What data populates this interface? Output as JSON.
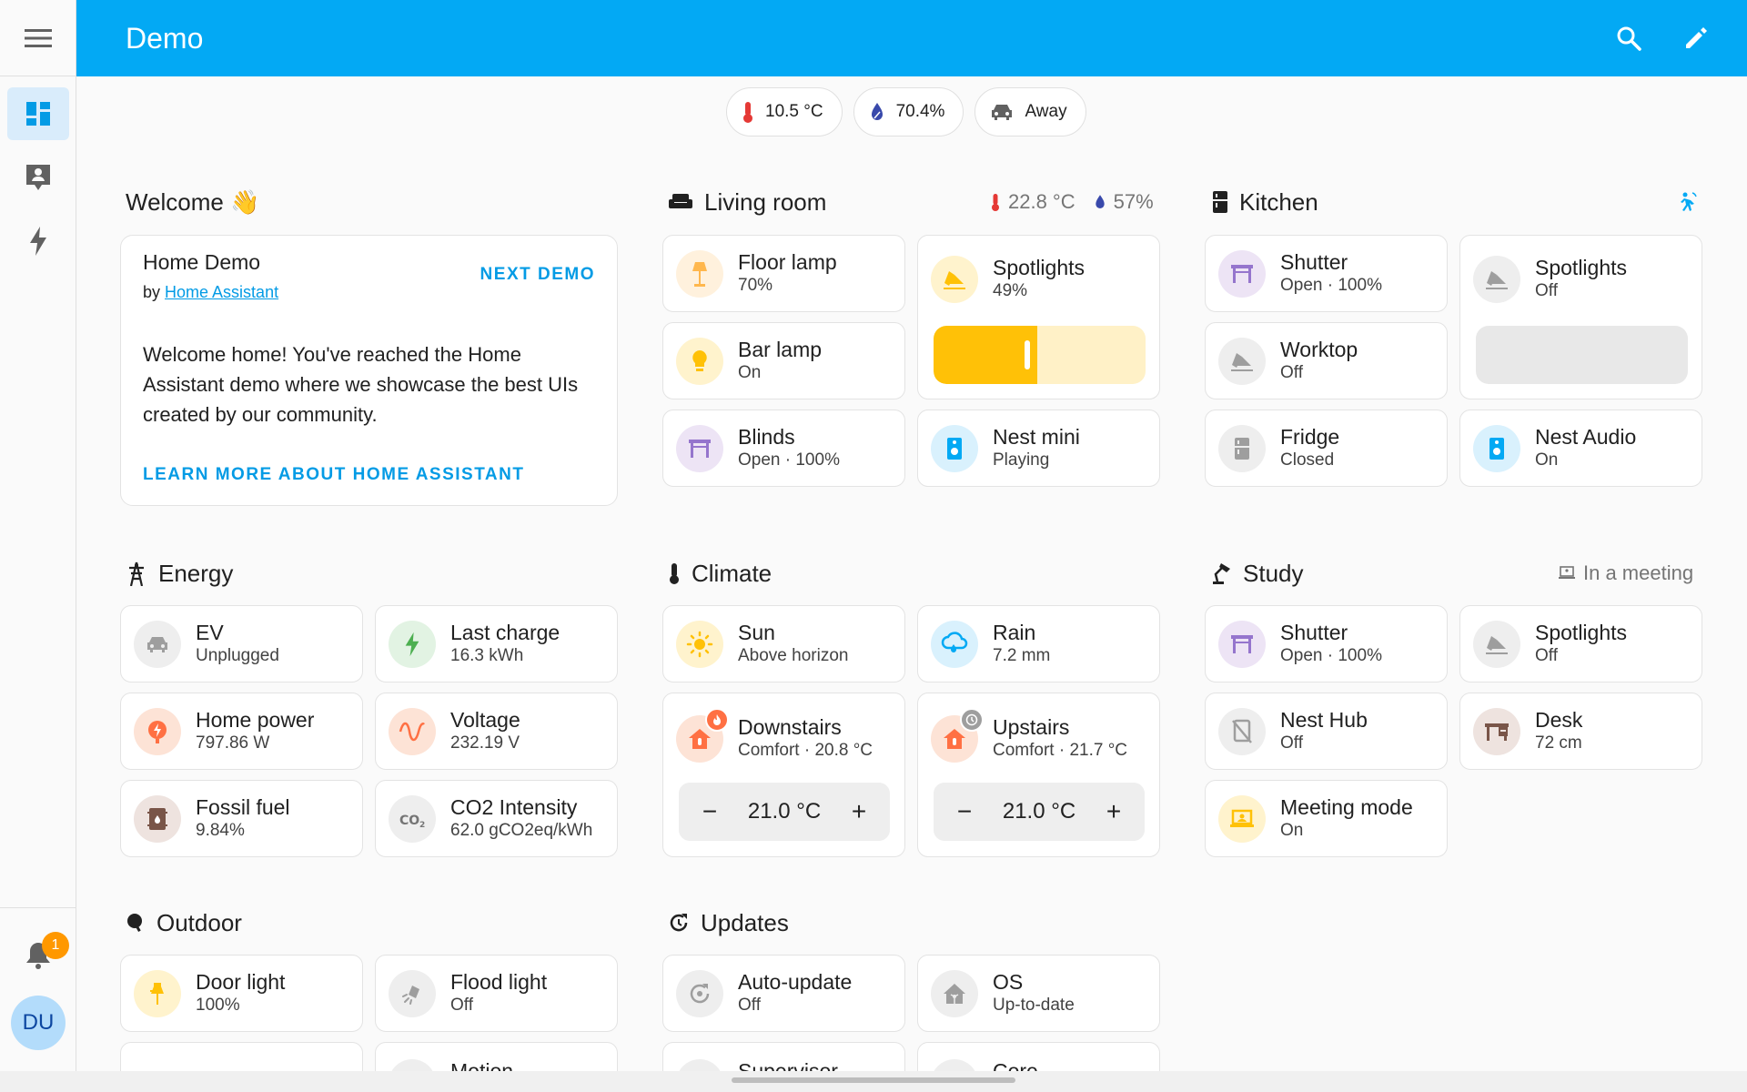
{
  "header": {
    "title": "Demo"
  },
  "badges": [
    {
      "icon": "thermometer-icon",
      "value": "10.5 °C"
    },
    {
      "icon": "water-percent-icon",
      "value": "70.4%"
    },
    {
      "icon": "car-icon",
      "value": "Away"
    }
  ],
  "sidebar": {
    "notification_count": "1",
    "avatar_initials": "DU"
  },
  "welcome": {
    "heading": "Welcome 👋",
    "title": "Home Demo",
    "by_prefix": "by",
    "by_link": "Home Assistant",
    "next_label": "NEXT DEMO",
    "body": "Welcome home! You've reached the Home Assistant demo where we showcase the best UIs created by our community.",
    "learn_label": "LEARN MORE ABOUT HOME ASSISTANT"
  },
  "living_room": {
    "title": "Living room",
    "temperature": "22.8 °C",
    "humidity": "57%",
    "cards": {
      "floor_lamp": {
        "name": "Floor lamp",
        "state": "70%"
      },
      "bar_lamp": {
        "name": "Bar lamp",
        "state": "On"
      },
      "blinds": {
        "name": "Blinds",
        "state": "Open · 100%"
      },
      "spotlights": {
        "name": "Spotlights",
        "state": "49%",
        "level": 0.49
      },
      "nest_mini": {
        "name": "Nest mini",
        "state": "Playing"
      }
    }
  },
  "kitchen": {
    "title": "Kitchen",
    "cards": {
      "shutter": {
        "name": "Shutter",
        "state": "Open · 100%"
      },
      "worktop": {
        "name": "Worktop",
        "state": "Off"
      },
      "fridge": {
        "name": "Fridge",
        "state": "Closed"
      },
      "spotlights": {
        "name": "Spotlights",
        "state": "Off"
      },
      "nest_audio": {
        "name": "Nest Audio",
        "state": "On"
      }
    }
  },
  "energy": {
    "title": "Energy",
    "cards": {
      "ev": {
        "name": "EV",
        "state": "Unplugged"
      },
      "last_charge": {
        "name": "Last charge",
        "state": "16.3 kWh"
      },
      "home_power": {
        "name": "Home power",
        "state": "797.86 W"
      },
      "voltage": {
        "name": "Voltage",
        "state": "232.19 V"
      },
      "fossil_fuel": {
        "name": "Fossil fuel",
        "state": "9.84%"
      },
      "co2": {
        "name": "CO2 Intensity",
        "state": "62.0 gCO2eq/kWh"
      }
    }
  },
  "climate": {
    "title": "Climate",
    "cards": {
      "sun": {
        "name": "Sun",
        "state": "Above horizon"
      },
      "rain": {
        "name": "Rain",
        "state": "7.2 mm"
      },
      "downstairs": {
        "name": "Downstairs",
        "state": "Comfort · 20.8 °C",
        "target": "21.0 °C"
      },
      "upstairs": {
        "name": "Upstairs",
        "state": "Comfort · 21.7 °C",
        "target": "21.0 °C"
      }
    }
  },
  "study": {
    "title": "Study",
    "status": "In a meeting",
    "cards": {
      "shutter": {
        "name": "Shutter",
        "state": "Open · 100%"
      },
      "spotlights": {
        "name": "Spotlights",
        "state": "Off"
      },
      "nest_hub": {
        "name": "Nest Hub",
        "state": "Off"
      },
      "desk": {
        "name": "Desk",
        "state": "72 cm"
      },
      "meeting_mode": {
        "name": "Meeting mode",
        "state": "On"
      }
    }
  },
  "outdoor": {
    "title": "Outdoor",
    "cards": {
      "door_light": {
        "name": "Door light",
        "state": "100%"
      },
      "flood_light": {
        "name": "Flood light",
        "state": "Off"
      },
      "motion": {
        "name": "Motion"
      }
    }
  },
  "updates": {
    "title": "Updates",
    "cards": {
      "auto_update": {
        "name": "Auto-update",
        "state": "Off"
      },
      "os": {
        "name": "OS",
        "state": "Up-to-date"
      },
      "supervisor": {
        "name": "Supervisor"
      },
      "core": {
        "name": "Core"
      }
    }
  },
  "controls": {
    "minus": "−",
    "plus": "+"
  },
  "colors": {
    "accent": "#03a9f4",
    "link": "#039be5",
    "light_on": "#ffc107"
  }
}
